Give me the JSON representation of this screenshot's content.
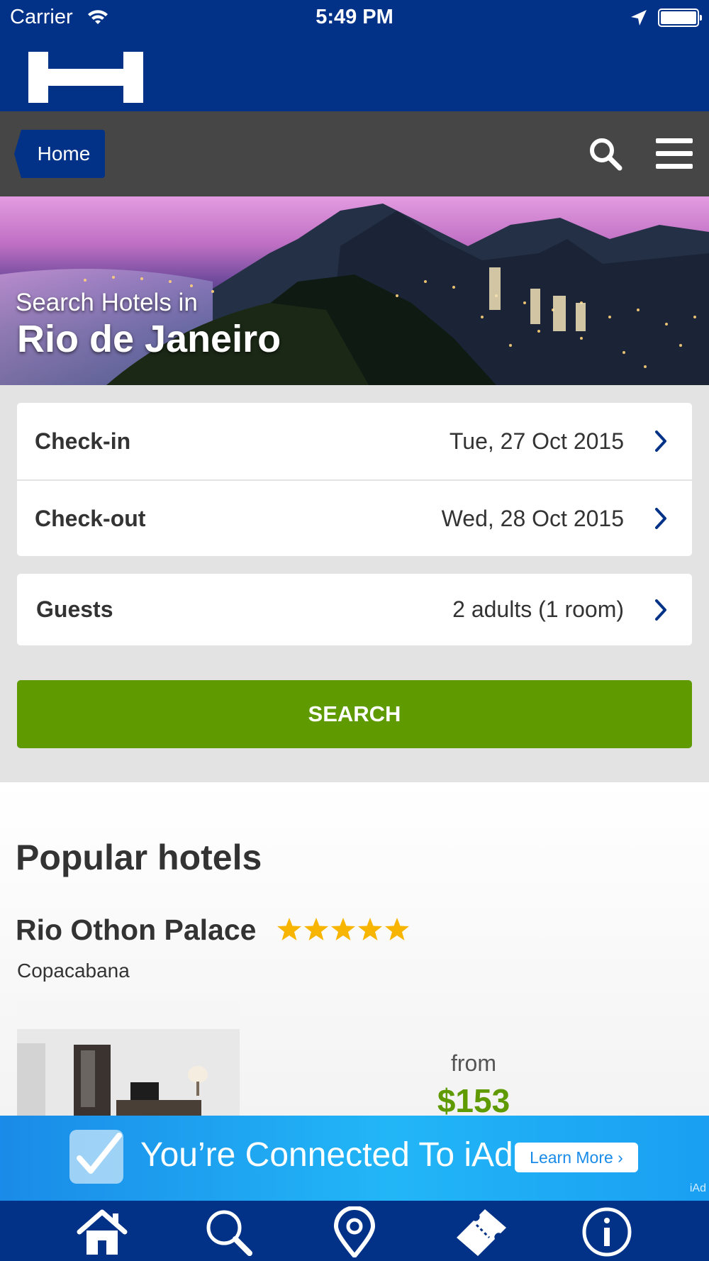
{
  "status_bar": {
    "carrier": "Carrier",
    "time": "5:49 PM"
  },
  "nav": {
    "home_label": "Home"
  },
  "hero": {
    "subtitle": "Search Hotels in",
    "title": "Rio de Janeiro"
  },
  "search_form": {
    "checkin": {
      "label": "Check-in",
      "value": "Tue, 27 Oct 2015"
    },
    "checkout": {
      "label": "Check-out",
      "value": "Wed, 28 Oct 2015"
    },
    "guests": {
      "label": "Guests",
      "value": "2 adults (1 room)"
    },
    "search_label": "SEARCH"
  },
  "popular": {
    "title": "Popular hotels",
    "hotels": [
      {
        "name": "Rio Othon Palace",
        "stars": 5,
        "area": "Copacabana",
        "price_from_label": "from",
        "price": "$153"
      }
    ]
  },
  "ad": {
    "text": "You’re Connected To iAd",
    "learn_more": "Learn More ›",
    "label": "iAd"
  },
  "tab_bar": {
    "tabs": [
      "home-icon",
      "search-icon",
      "location-pin-icon",
      "ticket-icon",
      "info-icon"
    ]
  },
  "colors": {
    "brand_blue": "#013287",
    "nav_gray": "#464646",
    "search_green": "#5f9a00",
    "star_yellow": "#f7b500",
    "chevron_blue": "#013287"
  }
}
